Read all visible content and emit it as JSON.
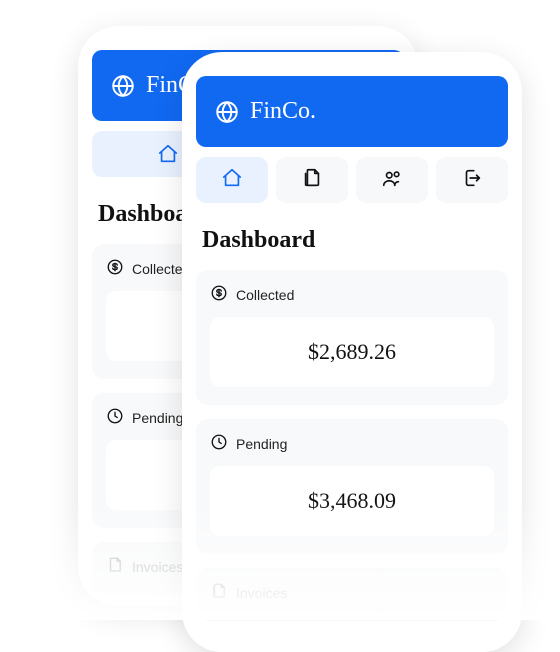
{
  "brand": {
    "name": "FinCo."
  },
  "nav": {
    "items": [
      {
        "icon": "home-icon",
        "active": true
      },
      {
        "icon": "document-icon",
        "active": false
      },
      {
        "icon": "users-icon",
        "active": false
      },
      {
        "icon": "logout-icon",
        "active": false
      }
    ]
  },
  "page": {
    "title": "Dashboard"
  },
  "cards": {
    "collected": {
      "label": "Collected",
      "value": "$2,689.26"
    },
    "pending": {
      "label": "Pending",
      "value": "$3,468.09"
    },
    "invoices": {
      "label": "Invoices"
    }
  }
}
